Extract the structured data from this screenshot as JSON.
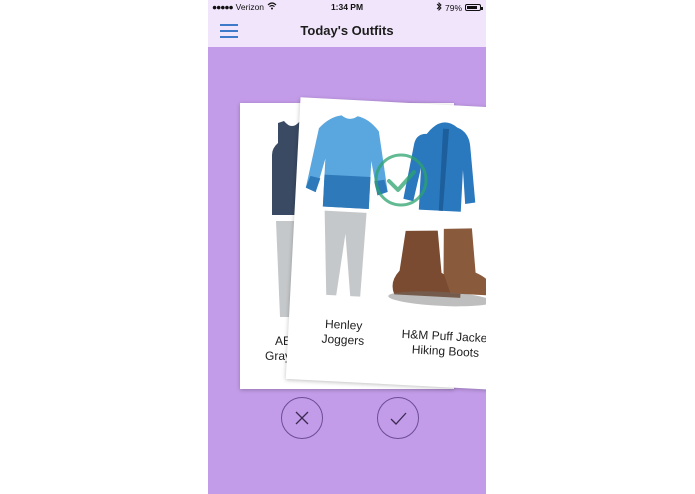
{
  "status_bar": {
    "carrier": "Verizon",
    "time": "1:34 PM",
    "battery": "79%",
    "battery_level": 0.79
  },
  "nav": {
    "title": "Today's Outfits",
    "menu_icon": "hamburger-icon"
  },
  "cards": {
    "back": {
      "line1": "AE",
      "line2": "Gray"
    },
    "front": {
      "line1": "Henley",
      "line2": "Joggers",
      "line3": "H&M Puff Jacket",
      "line4": "Hiking Boots"
    }
  },
  "actions": {
    "reject_icon": "close-icon",
    "accept_icon": "checkmark-icon"
  },
  "colors": {
    "background": "#c39ce9",
    "bar": "#f1e5fb",
    "accent": "#3f79c9",
    "button_border": "#6b4d93",
    "match_check": "#2ea36f"
  }
}
